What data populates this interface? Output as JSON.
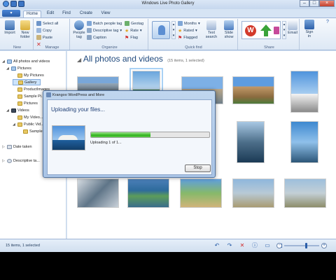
{
  "window": {
    "title": "Windows Live Photo Gallery"
  },
  "tabs": [
    "Home",
    "Edit",
    "Find",
    "Create",
    "View"
  ],
  "ribbon": {
    "new": {
      "import": "Import",
      "new_folder_1": "New",
      "new_folder_2": "folder",
      "label": "New"
    },
    "manage": {
      "select_all": "Select all",
      "copy": "Copy",
      "paste": "Paste",
      "label": "Manage"
    },
    "organize": {
      "people_tag_1": "People",
      "people_tag_2": "tag",
      "batch_people_tag": "Batch people tag",
      "descriptive_tag": "Descriptive tag",
      "caption": "Caption",
      "geotag": "Geotag",
      "rate": "Rate",
      "flag": "Flag",
      "label": "Organize"
    },
    "quickfind": {
      "months": "Months",
      "rated": "Rated",
      "flagged": "Flagged",
      "text_search_1": "Text",
      "text_search_2": "search",
      "slide_show_1": "Slide",
      "slide_show_2": "show",
      "label": "Quick find"
    },
    "share": {
      "email": "Email",
      "sign_in_1": "Sign",
      "sign_in_2": "in",
      "label": "Share"
    }
  },
  "tree": {
    "all": "All photos and videos",
    "pictures": "Pictures",
    "my_pictures": "My Pictures",
    "gallery": "Gallery",
    "product_images": "ProductImages",
    "sample_pictures": "Sample Pi...",
    "pictures2": "Pictures",
    "videos": "Videos",
    "my_videos": "My Video...",
    "public_videos": "Public Vid...",
    "sample": "Sample",
    "date_taken": "Date taken",
    "descriptive_tags": "Descriptive ta..."
  },
  "main": {
    "heading": "All photos and videos",
    "count": "(15 items, 1 selected)"
  },
  "dialog": {
    "title": "Krangoo WordPress and More",
    "heading": "Uploading your files...",
    "status": "Uploading 1 of 1...",
    "stop": "Stop",
    "progress": 0.5
  },
  "status_bar": {
    "text": "15 items, 1 selected"
  }
}
